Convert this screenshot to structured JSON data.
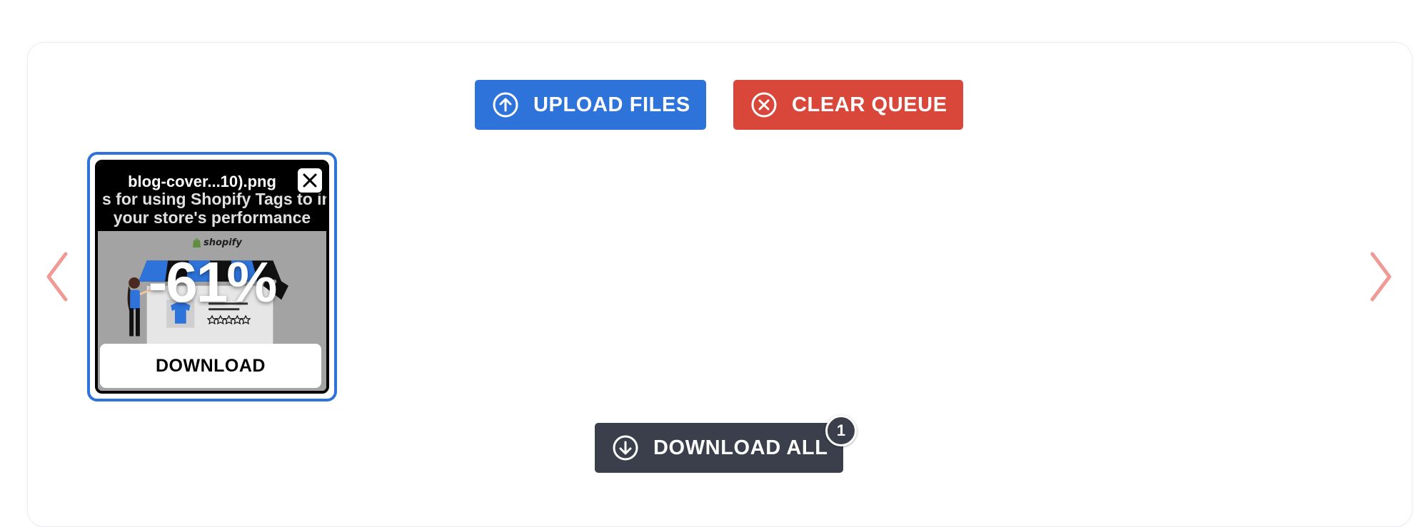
{
  "toolbar": {
    "upload_label": "UPLOAD FILES",
    "clear_label": "CLEAR QUEUE"
  },
  "queue": {
    "items": [
      {
        "filename": "blog-cover...10).png",
        "preview_line1": "s for using Shopify Tags to im",
        "preview_line2": "your store's performance",
        "preview_brand": "shopify",
        "savings_label": "-61%",
        "download_label": "DOWNLOAD"
      }
    ]
  },
  "footer": {
    "download_all_label": "DOWNLOAD ALL",
    "count": "1"
  },
  "colors": {
    "upload": "#2d73da",
    "clear": "#d8473a",
    "download_all": "#3a3f4b",
    "arrows": "#ef9a94",
    "card_border": "#2d73da"
  },
  "icons": {
    "upload": "arrow-up-circle-icon",
    "clear": "x-circle-icon",
    "download_all": "arrow-down-circle-icon",
    "prev": "chevron-left-icon",
    "next": "chevron-right-icon",
    "remove": "close-icon"
  }
}
